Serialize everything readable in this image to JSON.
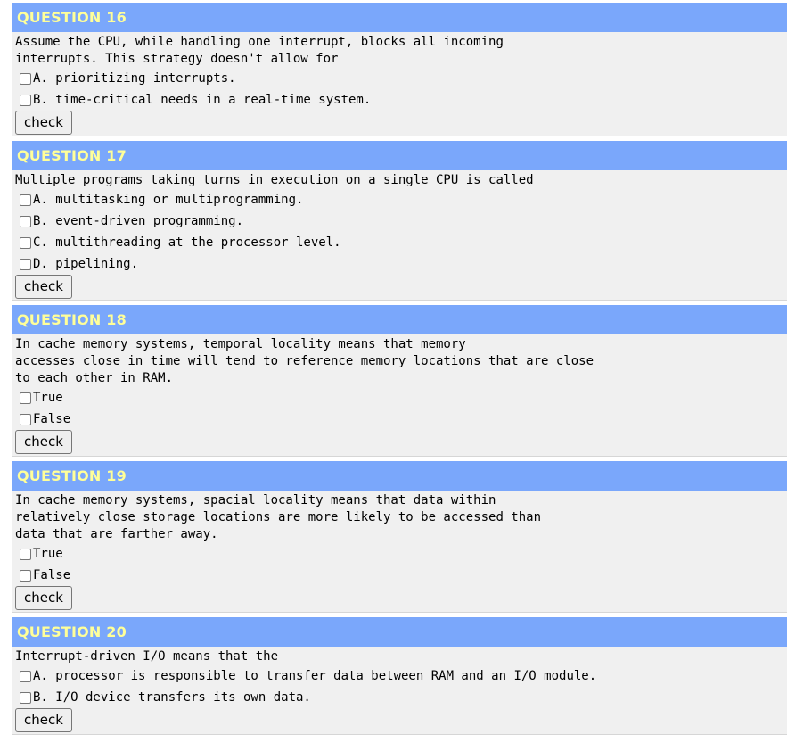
{
  "questions": [
    {
      "header": "QUESTION 16",
      "text": "Assume the CPU, while handling one interrupt, blocks all incoming\ninterrupts. This strategy doesn't allow for",
      "options": [
        "A. prioritizing interrupts.",
        "B. time-critical needs in a real-time system."
      ],
      "button": "check"
    },
    {
      "header": "QUESTION 17",
      "text": "Multiple programs taking turns in execution on a single CPU is called",
      "options": [
        "A. multitasking or multiprogramming.",
        "B. event-driven programming.",
        "C. multithreading at the processor level.",
        "D. pipelining."
      ],
      "button": "check"
    },
    {
      "header": "QUESTION 18",
      "text": "In cache memory systems, temporal locality means that memory\naccesses close in time will tend to reference memory locations that are close\nto each other in RAM.",
      "options": [
        "True",
        "False"
      ],
      "button": "check"
    },
    {
      "header": "QUESTION 19",
      "text": "In cache memory systems, spacial locality means that data within\nrelatively close storage locations are more likely to be accessed than\ndata that are farther away.",
      "options": [
        "True",
        "False"
      ],
      "button": "check"
    },
    {
      "header": "QUESTION 20",
      "text": "Interrupt-driven I/O means that the",
      "options": [
        "A. processor is responsible to transfer data between RAM and an I/O module.",
        "B. I/O device transfers its own data."
      ],
      "button": "check"
    }
  ]
}
